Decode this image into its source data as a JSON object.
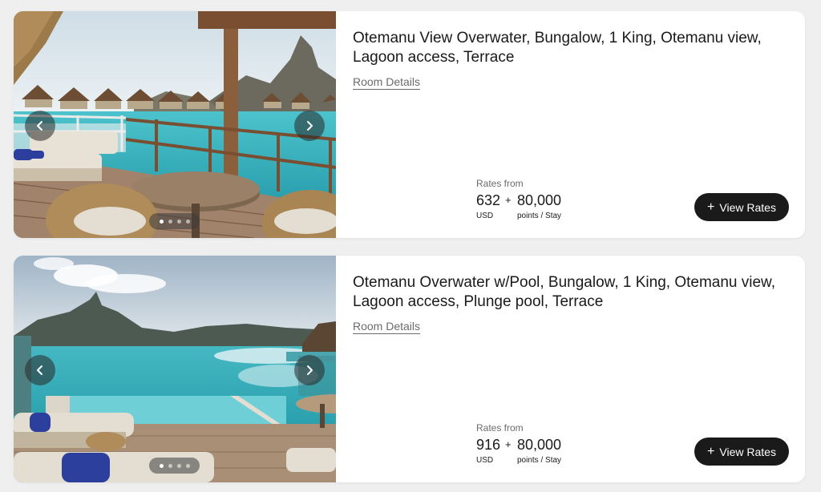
{
  "rooms": [
    {
      "title": "Otemanu View Overwater, Bungalow, 1 King, Otemanu view, Lagoon access, Terrace",
      "details_link": "Room Details",
      "rates_label": "Rates from",
      "price": "632",
      "currency": "USD",
      "plus": "+",
      "points": "80,000",
      "points_unit": "points / Stay",
      "button_label": "View Rates",
      "carousel": {
        "slide_count": 4,
        "active_slide": 1
      }
    },
    {
      "title": "Otemanu Overwater w/Pool, Bungalow, 1 King, Otemanu view, Lagoon access, Plunge pool, Terrace",
      "details_link": "Room Details",
      "rates_label": "Rates from",
      "price": "916",
      "currency": "USD",
      "plus": "+",
      "points": "80,000",
      "points_unit": "points / Stay",
      "button_label": "View Rates",
      "carousel": {
        "slide_count": 4,
        "active_slide": 1
      }
    }
  ],
  "icons": {
    "prev": "chevron-left-icon",
    "next": "chevron-right-icon",
    "add": "plus-icon"
  },
  "colors": {
    "page_bg": "#efefef",
    "card_bg": "#ffffff",
    "button_bg": "#1a1a1a",
    "lagoon": "#3fb7c4",
    "muted_text": "#6b6b6b"
  }
}
